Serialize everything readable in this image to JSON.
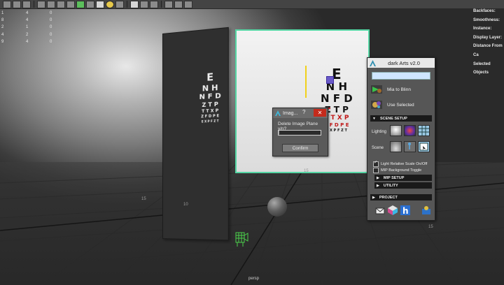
{
  "toolbar": {
    "icons": [
      "select-icon",
      "lasso-icon",
      "paint-icon",
      "move-icon",
      "rotate-icon",
      "scale-icon",
      "camera-icon",
      "grid-icon",
      "wireframe-icon",
      "smooth-icon",
      "light-icon",
      "shadow-icon",
      "isolate-icon",
      "xray-icon",
      "render-icon",
      "resolution-gate-icon",
      "film-gate-icon",
      "safe-area-icon"
    ]
  },
  "hud_left": {
    "rows": [
      {
        "a": "1",
        "b": "4",
        "c": "0"
      },
      {
        "a": "8",
        "b": "4",
        "c": "0"
      },
      {
        "a": "2",
        "b": "1",
        "c": "0"
      },
      {
        "a": "4",
        "b": "2",
        "c": "0"
      },
      {
        "a": "9",
        "b": "4",
        "c": "0"
      }
    ]
  },
  "hud_right": {
    "labels": [
      "Backfaces:",
      "Smoothness:",
      "Instance:",
      "Display Layer:",
      "Distance From Ca",
      "Selected Objects"
    ]
  },
  "eye_chart_left": {
    "rows": [
      "E",
      "N H",
      "N F D",
      "Z T P",
      "T T X P",
      "Z F D P E",
      "E X P F Z T"
    ]
  },
  "eye_chart_right": {
    "rows": [
      {
        "text": "E",
        "cls": "r1"
      },
      {
        "text": "N H",
        "cls": "r2"
      },
      {
        "text": "N F D",
        "cls": "r2"
      },
      {
        "text": "Z T P",
        "cls": "r3"
      },
      {
        "text": "T T X P",
        "cls": "r4"
      },
      {
        "text": "Z F D P E",
        "cls": "r5"
      },
      {
        "text": "E X P F Z T",
        "cls": "r6"
      }
    ]
  },
  "grid_labels": {
    "a": "15",
    "b": "15",
    "c": "10",
    "d": "10",
    "e": "15"
  },
  "viewport": {
    "camera_label": "persp"
  },
  "dialog": {
    "title": "Imag...",
    "help": "?",
    "close": "✕",
    "message": "Delete Image Plane y/n?",
    "input_value": "|",
    "confirm_label": "Confirm"
  },
  "panel": {
    "title": "dark Arts v2.0",
    "search_value": "",
    "mia_to_blinn": "Mia to Blinn",
    "use_selected": "Use Selected",
    "scene_setup": "SCENE SETUP",
    "lighting_label": "Lighting",
    "scene_label": "Scene",
    "light_relative": "Light Relative Scale On/Off",
    "mip_background": "MIP Background Toggle",
    "mip_setup": "MIP SETUP",
    "utility": "UTILITY",
    "project": "PROJECT"
  },
  "colors": {
    "selection_green": "#55d6a4",
    "axis_y": "#f1d11b",
    "axis_x": "#d03030",
    "close_red": "#c42b1c",
    "search_blue": "#cfe6ff"
  }
}
